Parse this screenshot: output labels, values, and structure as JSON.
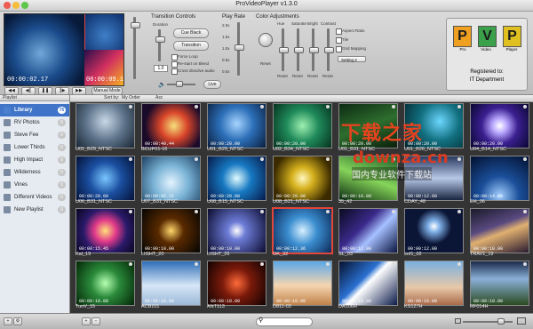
{
  "window": {
    "title": "ProVideoPlayer v1.3.0"
  },
  "preview": {
    "timecode_left": "00:00:02.17",
    "timecode_right": "00:00:09.13"
  },
  "transport": {
    "manual_mode": "Manual Mode",
    "live": "Live"
  },
  "transition_controls": {
    "title": "Transition Controls",
    "duration_label": "Duration",
    "duration_value": "1.0",
    "cue_black": "Cue Black",
    "transition": "Transition",
    "force_loop": "Force Loop",
    "restart_on_blend": "Re-start on Blend",
    "cross_dissolve_audio": "Cross dissolve audio"
  },
  "play_rate": {
    "title": "Play Rate",
    "ticks": [
      "2.0x",
      "1.5x",
      "1.0x",
      "0.5x",
      "0.0x"
    ]
  },
  "color_adjustments": {
    "title": "Color Adjustments",
    "columns": [
      "Hue",
      "Saturate",
      "Bright",
      "Contrast"
    ],
    "reset": "Reset"
  },
  "options": {
    "aspect_ratio": "Aspect Ratio",
    "tile": "Tile",
    "grid_mapping": "Grid Mapping",
    "setting": "Setting 2"
  },
  "logo": {
    "letters": [
      "P",
      "V",
      "P"
    ],
    "words": [
      "Pro",
      "Video",
      "Player"
    ],
    "registered_to": "Registered to:",
    "org": "IT Department"
  },
  "playlist": {
    "header": "Playlist",
    "items": [
      {
        "label": "Library",
        "count": "76",
        "selected": true
      },
      {
        "label": "RV Photos",
        "count": "0",
        "selected": false
      },
      {
        "label": "Steve Fee",
        "count": "0",
        "selected": false
      },
      {
        "label": "Lower Thirds",
        "count": "0",
        "selected": false
      },
      {
        "label": "High Impact",
        "count": "0",
        "selected": false
      },
      {
        "label": "Wilderness",
        "count": "0",
        "selected": false
      },
      {
        "label": "Vines",
        "count": "0",
        "selected": false
      },
      {
        "label": "Different Videos",
        "count": "0",
        "selected": false
      },
      {
        "label": "New Playlist",
        "count": "0",
        "selected": false
      }
    ]
  },
  "sort": {
    "label": "Sort by:",
    "value": "My Order",
    "direction": "Asc"
  },
  "clips": [
    {
      "name": "U01_B29_NTSC",
      "tc": "",
      "bg": "radial-gradient(circle at 50% 40%,#c9d8e8,#5d738a 50%,#1a2633)"
    },
    {
      "name": "BCUP01-16",
      "tc": "00:00:40.44",
      "bg": "radial-gradient(circle at 55% 50%,#f6e07a,#d9462a 35%,#1a0a2a 75%)"
    },
    {
      "name": "U01_B29_NTSC",
      "tc": "00:00:20.00",
      "bg": "radial-gradient(circle at 50% 45%,#a7d4ff,#2c6fb8 45%,#0a1e3e)"
    },
    {
      "name": "U02_B34_NTSC",
      "tc": "00:00:20.00",
      "bg": "radial-gradient(circle at 50% 50%,#9ef0b0,#1f8a5a 45%,#06321f)"
    },
    {
      "name": "U01_B31_NTSC",
      "tc": "00:00:20.00",
      "bg": "linear-gradient(160deg,#0c2a12,#2e6e2e 50%,#0b1f0b)"
    },
    {
      "name": "U01_B26_NTSC",
      "tc": "00:00:20.00",
      "bg": "radial-gradient(circle at 60% 40%,#6cd7ff,#127080 45%,#02242c)"
    },
    {
      "name": "U04_B14_NTSC",
      "tc": "00:00:20.00",
      "bg": "radial-gradient(circle at 50% 50%,#fff,#b9a8ff 20%,#3a2090 50%,#0a0630)"
    },
    {
      "name": "U06_B31_NTSC",
      "tc": "00:00:20.00",
      "bg": "radial-gradient(circle at 50% 50%,#79c6ff,#1b4fa0 45%,#041238)"
    },
    {
      "name": "U07_B31_NTSC",
      "tc": "00:00:05.21",
      "bg": "radial-gradient(circle at 50% 60%,#e4f4ff,#7ab3d6 45%,#1c3f61)"
    },
    {
      "name": "U08_B15_NTSC",
      "tc": "00:00:20.00",
      "bg": "radial-gradient(circle at 50% 50%,#e0fbff,#1779c2 40%,#061a4a)"
    },
    {
      "name": "U08_B21_NTSC",
      "tc": "00:00:20.00",
      "bg": "radial-gradient(circle at 50% 50%,#fff8c0,#d6b11d 30%,#3a2a00 80%)"
    },
    {
      "name": "35_42",
      "tc": "00:00:10.00",
      "bg": "linear-gradient(200deg,#1a5d2a,#86d45a 50%,#0a2a10)"
    },
    {
      "name": "CDAY_48",
      "tc": "00:00:12.00",
      "bg": "linear-gradient(180deg,#2a3a60,#b7c8e8 50%,#192540)"
    },
    {
      "name": "EH_06",
      "tc": "00:00:14.00",
      "bg": "radial-gradient(circle at 50% 90%,#a3cfff,#1b4f9a 40%,#02102e)"
    },
    {
      "name": "Kal_19",
      "tc": "00:00:15.45",
      "bg": "radial-gradient(circle at 50% 50%,#ffe17a,#e23a8a 30%,#2a1a6a 60%,#0a0520)"
    },
    {
      "name": "LIGHT_20",
      "tc": "00:00:10.00",
      "bg": "radial-gradient(circle at 50% 50%,#ffd66b,#5a2a00 35%,#040404)"
    },
    {
      "name": "LIGHT_26",
      "tc": "00:00:10.00",
      "bg": "radial-gradient(circle at 50% 50%,#fff,#6c7bd6 25%,#0b0b2e)"
    },
    {
      "name": "OK_32",
      "tc": "00:00:12.36",
      "bg": "radial-gradient(circle at 50% 50%,#d8f0ff,#3b8ed0 40%,#0c2a5a)",
      "selected": true
    },
    {
      "name": "SL_03",
      "tc": "00:00:12.00",
      "bg": "linear-gradient(135deg,#0a0a20,#3a2a8a 40%,#a6c0ff 60%,#0a1440)"
    },
    {
      "name": "sof1_02",
      "tc": "00:00:12.00",
      "bg": "radial-gradient(circle at 50% 40%,#fff,#7fb0e8 15%,#0b1536 45%)"
    },
    {
      "name": "TRAV1_19",
      "tc": "00:00:10.00",
      "bg": "linear-gradient(160deg,#1a1a2a,#5a4a80 40%,#e0b070 55%,#2a1a30)"
    },
    {
      "name": "TunV_15",
      "tc": "00:00:10.00",
      "bg": "radial-gradient(circle at 50% 50%,#b6ffb0,#2a8a3a 40%,#042608)"
    },
    {
      "name": "ACB101",
      "tc": "00:00:10.00",
      "bg": "linear-gradient(180deg,#2f6fb8,#d7e6f7 55%,#9bb9d8)"
    },
    {
      "name": "ANT113",
      "tc": "00:00:10.00",
      "bg": "radial-gradient(circle at 50% 50%,#ff6a3a,#7a1a0a 40%,#100202)"
    },
    {
      "name": "D811-03",
      "tc": "00:00:10.00",
      "bg": "linear-gradient(180deg,#5aa8e8,#f5d5b0 55%,#c0824a)"
    },
    {
      "name": "DA106H",
      "tc": "00:00:10.00",
      "bg": "linear-gradient(135deg,#06122e,#2a6fd0 40%,#ffffff 50%,#0a1a4a)"
    },
    {
      "name": "KS127H",
      "tc": "00:00:10.00",
      "bg": "linear-gradient(180deg,#7ab0e0,#e8c8a8 60%,#a86a4a)"
    },
    {
      "name": "RF014H",
      "tc": "00:00:10.00",
      "bg": "linear-gradient(180deg,#1a2a4a,#8ab0d8 40%,#2a4a20)"
    }
  ],
  "watermark": {
    "line1": "下载之家",
    "line2": "downza.cn",
    "line3": "国内专业软件下载站"
  }
}
